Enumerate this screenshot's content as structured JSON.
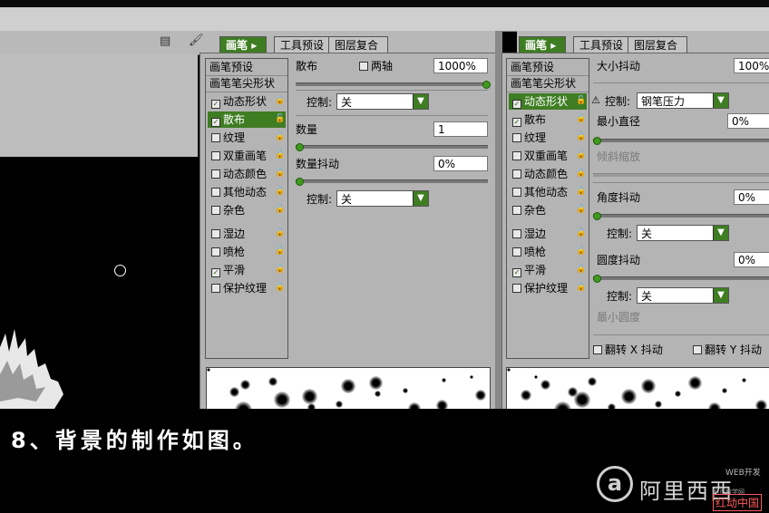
{
  "caption": "8、背景的制作如图。",
  "watermark": {
    "small": "WEB开发",
    "main": "阿里西西",
    "mark": "a",
    "sub": "网页教学网",
    "stamp": "红动中国"
  },
  "panel_left": {
    "tabs": [
      "画笔",
      "工具预设",
      "图层复合"
    ],
    "list_head": "画笔预设",
    "list_items": [
      {
        "label": "画笔笔尖形状",
        "check": false,
        "head": true
      },
      {
        "label": "动态形状",
        "check": true
      },
      {
        "label": "散布",
        "check": true,
        "selected": true
      },
      {
        "label": "纹理",
        "check": false
      },
      {
        "label": "双重画笔",
        "check": false
      },
      {
        "label": "动态颜色",
        "check": false
      },
      {
        "label": "其他动态",
        "check": false
      },
      {
        "label": "杂色",
        "check": false
      },
      {
        "label": "湿边",
        "check": false
      },
      {
        "label": "喷枪",
        "check": false
      },
      {
        "label": "平滑",
        "check": true
      },
      {
        "label": "保护纹理",
        "check": false
      }
    ],
    "scatter_label": "散布",
    "both_axes_label": "两轴",
    "scatter_value": "1000%",
    "control_label": "控制:",
    "control_value": "关",
    "count_label": "数量",
    "count_value": "1",
    "count_jitter_label": "数量抖动",
    "count_jitter_value": "0%",
    "control2_label": "控制:",
    "control2_value": "关"
  },
  "panel_right": {
    "tabs": [
      "画笔",
      "工具预设",
      "图层复合"
    ],
    "list_head": "画笔预设",
    "list_items": [
      {
        "label": "画笔笔尖形状",
        "check": false,
        "head": true
      },
      {
        "label": "动态形状",
        "check": true,
        "selected": true
      },
      {
        "label": "散布",
        "check": true
      },
      {
        "label": "纹理",
        "check": false
      },
      {
        "label": "双重画笔",
        "check": false
      },
      {
        "label": "动态颜色",
        "check": false
      },
      {
        "label": "其他动态",
        "check": false
      },
      {
        "label": "杂色",
        "check": false
      },
      {
        "label": "湿边",
        "check": false
      },
      {
        "label": "喷枪",
        "check": false
      },
      {
        "label": "平滑",
        "check": true
      },
      {
        "label": "保护纹理",
        "check": false
      }
    ],
    "size_jitter_label": "大小抖动",
    "size_jitter_value": "100%",
    "control_label": "控制:",
    "control_value": "钢笔压力",
    "min_diameter_label": "最小直径",
    "min_diameter_value": "0%",
    "tilt_scale_label": "倾斜缩放",
    "angle_jitter_label": "角度抖动",
    "angle_jitter_value": "0%",
    "control2_label": "控制:",
    "control2_value": "关",
    "roundness_jitter_label": "圆度抖动",
    "roundness_jitter_value": "0%",
    "control3_label": "控制:",
    "control3_value": "关",
    "min_roundness_label": "最小圆度",
    "flip_x_label": "翻转 X 抖动",
    "flip_y_label": "翻转 Y 抖动"
  },
  "icons": {
    "doc": "document-icon",
    "brush": "brush-icon",
    "lock": "lock-icon",
    "warning": "warning-icon",
    "dropdown": "chevron-down-icon"
  },
  "colors": {
    "accent": "#3f7d23",
    "panel": "#b4b4b4"
  }
}
